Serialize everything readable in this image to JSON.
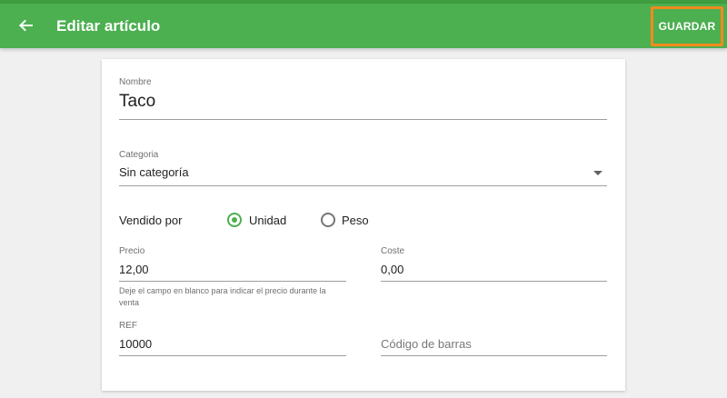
{
  "header": {
    "title": "Editar artículo",
    "save_label": "GUARDAR"
  },
  "form": {
    "name": {
      "label": "Nombre",
      "value": "Taco"
    },
    "category": {
      "label": "Categoria",
      "value": "Sin categoría"
    },
    "sold_by": {
      "label": "Vendido por",
      "options": [
        {
          "label": "Unidad",
          "selected": true
        },
        {
          "label": "Peso",
          "selected": false
        }
      ]
    },
    "price": {
      "label": "Precio",
      "value": "12,00",
      "helper": "Deje el campo en blanco para indicar el precio durante la venta"
    },
    "cost": {
      "label": "Coste",
      "value": "0,00"
    },
    "ref": {
      "label": "REF",
      "value": "10000"
    },
    "barcode": {
      "placeholder": "Código de barras",
      "value": ""
    }
  },
  "colors": {
    "appbar": "#4caf50",
    "accent": "#4caf50",
    "highlight": "#f28a1e"
  },
  "icons": {
    "back": "arrow-left-icon",
    "dropdown": "caret-down-icon"
  }
}
